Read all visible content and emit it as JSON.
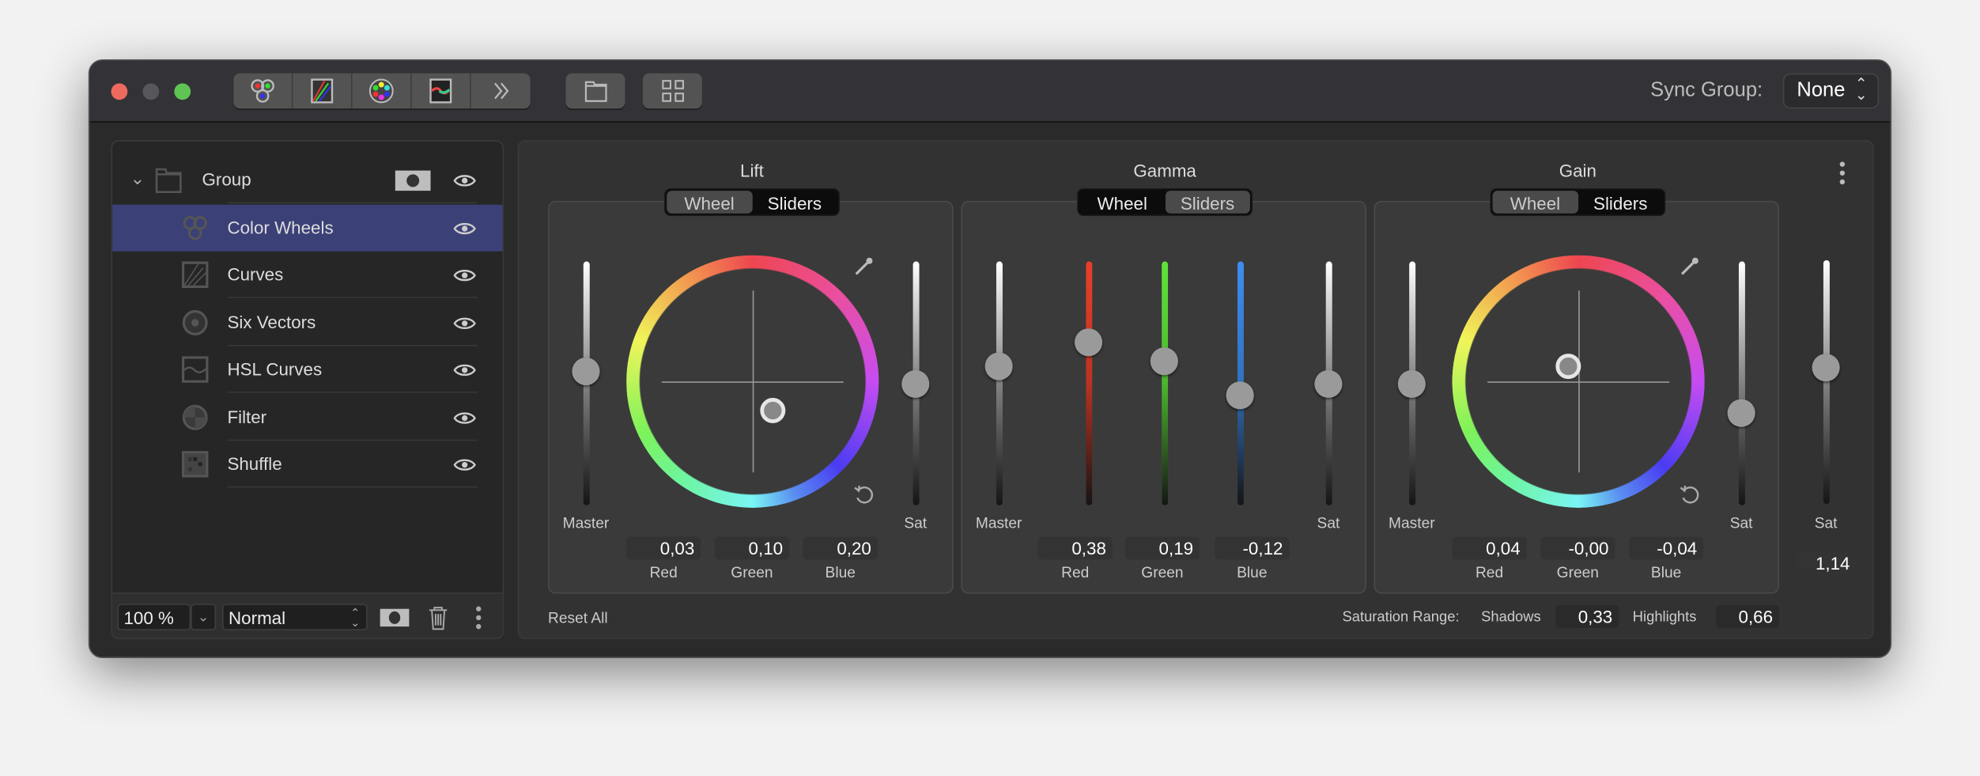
{
  "window": {
    "sync_label": "Sync Group:",
    "sync_value": "None"
  },
  "toolbar": {
    "tabs": [
      "color-wheels-icon",
      "curves-icon",
      "six-vectors-icon",
      "hsl-curves-icon",
      "more-chevrons-icon"
    ],
    "buttons": [
      "folder-icon",
      "grid-icon"
    ]
  },
  "layers": {
    "items": [
      {
        "label": "Group",
        "icon": "folder-icon",
        "group": true
      },
      {
        "label": "Color Wheels",
        "icon": "color-wheels-icon",
        "selected": true
      },
      {
        "label": "Curves",
        "icon": "curves-icon"
      },
      {
        "label": "Six Vectors",
        "icon": "six-vectors-icon"
      },
      {
        "label": "HSL Curves",
        "icon": "hsl-curves-icon"
      },
      {
        "label": "Filter",
        "icon": "filter-icon"
      },
      {
        "label": "Shuffle",
        "icon": "shuffle-icon"
      }
    ],
    "opacity": "100 %",
    "blend_mode": "Normal"
  },
  "panels": [
    {
      "title": "Lift",
      "modes": [
        "Wheel",
        "Sliders"
      ],
      "mode": "Wheel",
      "master_label": "Master",
      "sat_label": "Sat",
      "master": 0.55,
      "sat": 0.5,
      "wheel_offset": [
        0.16,
        -0.24
      ],
      "values": [
        {
          "label": "Red",
          "value": "0,03"
        },
        {
          "label": "Green",
          "value": "0,10"
        },
        {
          "label": "Blue",
          "value": "0,20"
        }
      ]
    },
    {
      "title": "Gamma",
      "modes": [
        "Wheel",
        "Sliders"
      ],
      "mode": "Sliders",
      "master_label": "Master",
      "sat_label": "Sat",
      "master": 0.57,
      "sat": 0.5,
      "channels": [
        0.67,
        0.59,
        0.45
      ],
      "values": [
        {
          "label": "Red",
          "value": "0,38"
        },
        {
          "label": "Green",
          "value": "0,19"
        },
        {
          "label": "Blue",
          "value": "-0,12"
        }
      ]
    },
    {
      "title": "Gain",
      "modes": [
        "Wheel",
        "Sliders"
      ],
      "mode": "Wheel",
      "master_label": "Master",
      "sat_label": "Sat",
      "master": 0.5,
      "sat": 0.38,
      "wheel_offset": [
        -0.08,
        0.12
      ],
      "values": [
        {
          "label": "Red",
          "value": "0,04"
        },
        {
          "label": "Green",
          "value": "-0,00"
        },
        {
          "label": "Blue",
          "value": "-0,04"
        }
      ]
    }
  ],
  "global_sat": {
    "label": "Sat",
    "value": "1,14",
    "level": 0.56
  },
  "footer": {
    "reset": "Reset All",
    "sat_range_label": "Saturation Range:",
    "shadows_label": "Shadows",
    "shadows": "0,33",
    "highlights_label": "Highlights",
    "highlights": "0,66"
  },
  "colors": {
    "selection": "#3b4077",
    "red": "#e8402a",
    "green": "#5fe33a",
    "blue": "#3d8ef0",
    "close": "#ee6a5f",
    "zoom": "#5fc454"
  }
}
